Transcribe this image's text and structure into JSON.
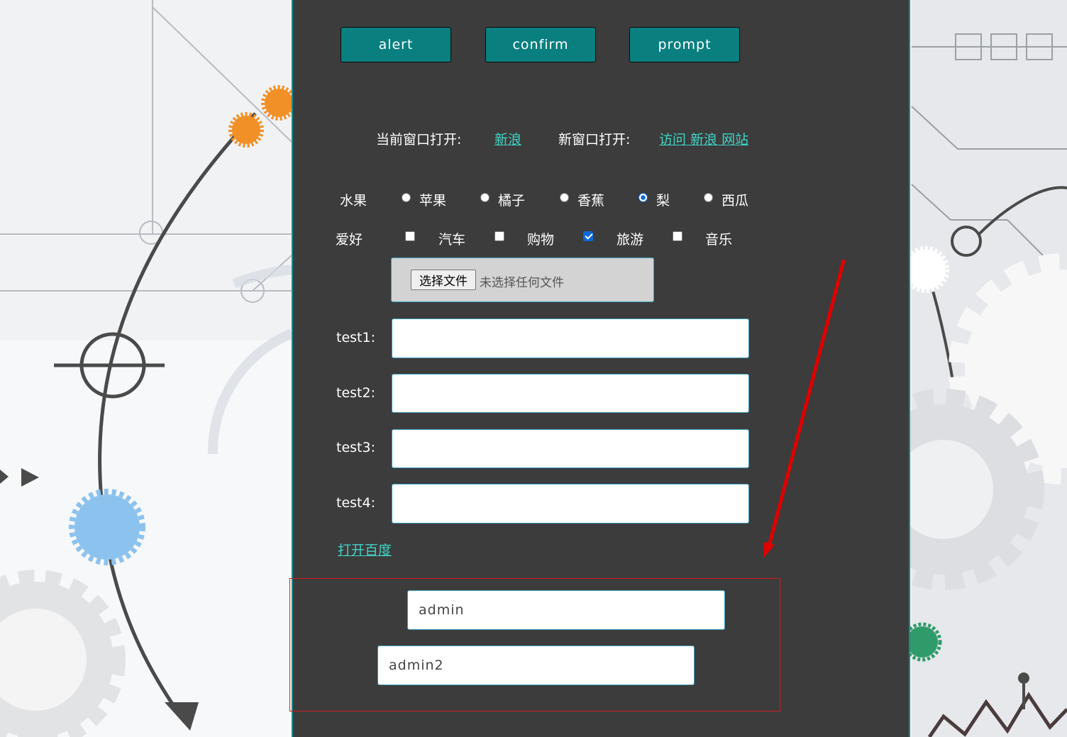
{
  "buttons": {
    "alert_label": "alert",
    "confirm_label": "confirm",
    "prompt_label": "prompt"
  },
  "links_row": {
    "current_window_label": "当前窗口打开:",
    "current_window_link": "新浪",
    "new_window_label": "新窗口打开:",
    "new_window_link": "访问 新浪 网站"
  },
  "fruit": {
    "label": "水果",
    "options": [
      "苹果",
      "橘子",
      "香蕉",
      "梨",
      "西瓜"
    ],
    "selected": "梨"
  },
  "hobby": {
    "label": "爱好",
    "options": [
      "汽车",
      "购物",
      "旅游",
      "音乐"
    ],
    "checked": [
      "旅游"
    ]
  },
  "file_upload": {
    "button_label": "选择文件",
    "status": "未选择任何文件"
  },
  "fields": [
    {
      "label": "test1:",
      "value": ""
    },
    {
      "label": "test2:",
      "value": ""
    },
    {
      "label": "test3:",
      "value": ""
    },
    {
      "label": "test4:",
      "value": ""
    }
  ],
  "baidu_link": "打开百度",
  "highlight_inputs": {
    "input1": "admin",
    "input2": "admin2"
  },
  "colors": {
    "panel_bg": "#3c3c3c",
    "button_bg": "#0a7f7f",
    "link": "#3fd4c6",
    "annotation": "#e00000"
  }
}
